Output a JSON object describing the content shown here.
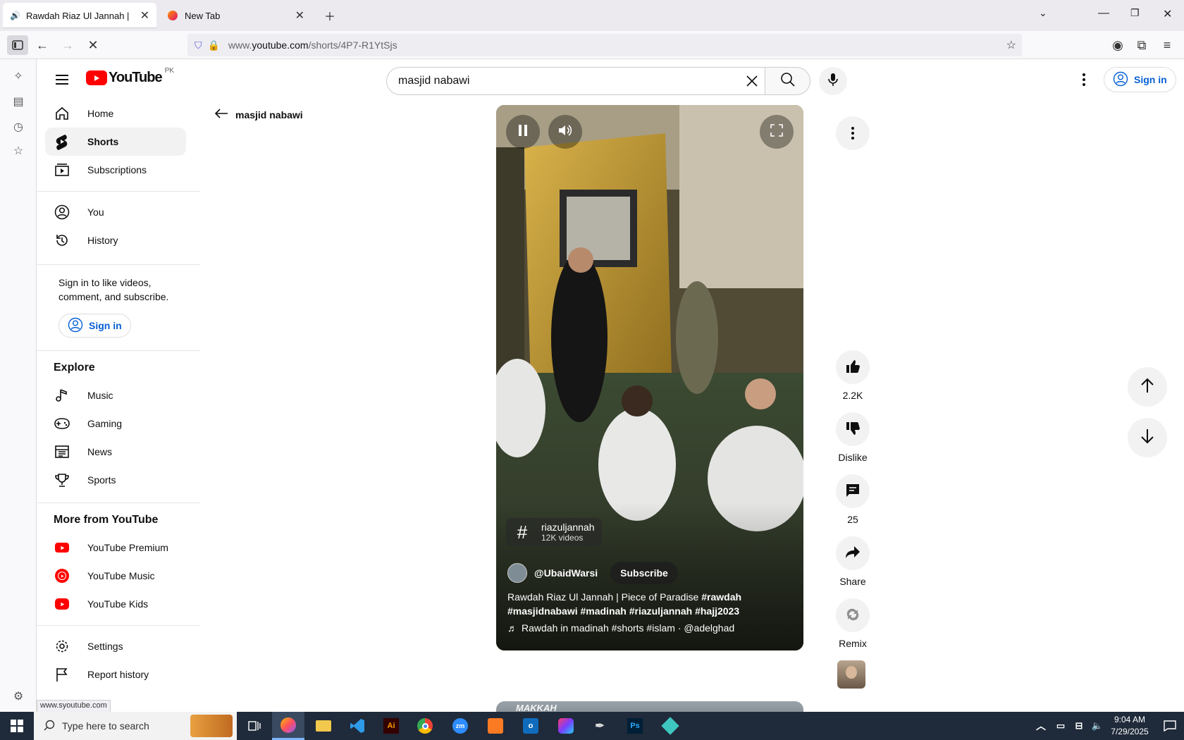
{
  "browser": {
    "tabs": [
      {
        "title": "Rawdah Riaz Ul Jannah | Pie",
        "active": true
      },
      {
        "title": "New Tab",
        "active": false
      }
    ],
    "url_prefix": "www.",
    "url_domain": "youtube.com",
    "url_path": "/shorts/4P7-R1YtSjs",
    "status_url": "www.syoutube.com"
  },
  "masthead": {
    "logo_text": "YouTube",
    "region": "PK",
    "search_value": "masjid nabawi",
    "sign_in": "Sign in"
  },
  "guide": {
    "main": [
      {
        "label": "Home",
        "icon": "home-icon"
      },
      {
        "label": "Shorts",
        "icon": "shorts-icon"
      },
      {
        "label": "Subscriptions",
        "icon": "subscriptions-icon"
      }
    ],
    "you": [
      {
        "label": "You",
        "icon": "account-icon"
      },
      {
        "label": "History",
        "icon": "history-icon"
      }
    ],
    "signin_prompt": "Sign in to like videos, comment, and subscribe.",
    "signin_button": "Sign in",
    "explore_title": "Explore",
    "explore": [
      {
        "label": "Music",
        "icon": "music-icon"
      },
      {
        "label": "Gaming",
        "icon": "gaming-icon"
      },
      {
        "label": "News",
        "icon": "news-icon"
      },
      {
        "label": "Sports",
        "icon": "trophy-icon"
      }
    ],
    "more_title": "More from YouTube",
    "more": [
      {
        "label": "YouTube Premium"
      },
      {
        "label": "YouTube Music"
      },
      {
        "label": "YouTube Kids"
      }
    ],
    "bottom": [
      {
        "label": "Settings",
        "icon": "gear-icon"
      },
      {
        "label": "Report history",
        "icon": "flag-icon"
      }
    ]
  },
  "back_query": "masjid nabawi",
  "short": {
    "hashtag": "riazuljannah",
    "hashtag_count": "12K videos",
    "channel": "@UbaidWarsi",
    "subscribe": "Subscribe",
    "title_plain": "Rawdah Riaz Ul Jannah | Piece of Paradise ",
    "title_tags": "#rawdah #masjidnabawi #madinah #riazuljannah #hajj2023",
    "sound": "Rawdah in madinah #shorts #islam · @adelghad"
  },
  "actions": {
    "likes": "2.2K",
    "dislike": "Dislike",
    "comments": "25",
    "share": "Share",
    "remix": "Remix"
  },
  "next_short_label": "MAKKAH",
  "taskbar": {
    "search_placeholder": "Type here to search",
    "time": "9:04 AM",
    "date": "7/29/2025",
    "apps": [
      "Ai",
      "zm",
      "Ps"
    ]
  },
  "colors": {
    "youtube_red": "#ff0000",
    "link_blue": "#065fd4",
    "taskbar": "#1f2a3a"
  }
}
